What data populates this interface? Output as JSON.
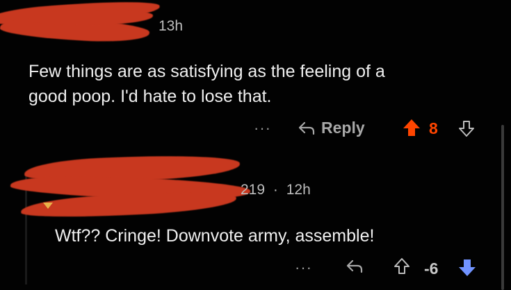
{
  "comment1": {
    "time": "13h",
    "text_line1": "Few things are as satisfying as the feeling of a",
    "text_line2": "good poop. I'd hate to lose that.",
    "more": "···",
    "reply_label": "Reply",
    "score": "8",
    "upvoted": true,
    "upvote_color": "#ff4500"
  },
  "comment2": {
    "author_fragment": "219",
    "separator": "·",
    "time": "12h",
    "text": "Wtf?? Cringe! Downvote army, assemble!",
    "more": "···",
    "score": "-6",
    "downvoted": true,
    "downvote_color": "#7193ff"
  },
  "icons": {
    "reply": "reply-arrow-icon",
    "upvote": "upvote-arrow-icon",
    "downvote": "downvote-arrow-icon",
    "more": "more-options-icon"
  },
  "colors": {
    "background": "#020202",
    "redaction": "#c8381f"
  }
}
